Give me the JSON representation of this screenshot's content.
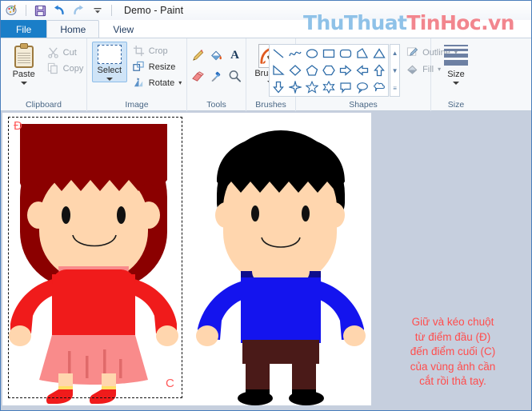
{
  "window": {
    "title": "Demo - Paint",
    "quick_access": [
      {
        "name": "paint-app-icon",
        "glyph": "🎨"
      },
      {
        "name": "save-icon",
        "glyph": "💾"
      },
      {
        "name": "undo-icon",
        "glyph": "↶"
      },
      {
        "name": "redo-icon",
        "glyph": "↷"
      },
      {
        "name": "customize-quick-access-icon",
        "glyph": "▾"
      }
    ]
  },
  "tabs": [
    {
      "label": "File",
      "type": "file"
    },
    {
      "label": "Home",
      "type": "active"
    },
    {
      "label": "View",
      "type": "normal"
    }
  ],
  "ribbon": {
    "clipboard": {
      "label": "Clipboard",
      "paste": "Paste",
      "cut": "Cut",
      "copy": "Copy"
    },
    "image": {
      "label": "Image",
      "select": "Select",
      "crop": "Crop",
      "resize": "Resize",
      "rotate": "Rotate"
    },
    "tools": {
      "label": "Tools",
      "items": [
        {
          "name": "pencil-tool-icon",
          "glyph": "✏"
        },
        {
          "name": "fill-with-color-icon",
          "glyph": "🪣"
        },
        {
          "name": "text-tool-icon",
          "glyph": "A"
        },
        {
          "name": "eraser-tool-icon",
          "glyph": "▬"
        },
        {
          "name": "color-picker-icon",
          "glyph": "💉"
        },
        {
          "name": "magnifier-tool-icon",
          "glyph": "🔍"
        }
      ]
    },
    "brushes": {
      "label": "Brushes",
      "button": "Brushes"
    },
    "shapes": {
      "label": "Shapes",
      "outline": "Outline",
      "fill": "Fill",
      "items": [
        "line",
        "curve",
        "oval",
        "rectangle",
        "rounded-rectangle",
        "polygon",
        "triangle",
        "right-triangle",
        "diamond",
        "pentagon",
        "hexagon",
        "right-arrow",
        "left-arrow",
        "up-arrow",
        "down-arrow",
        "four-point-star",
        "five-point-star",
        "six-point-star",
        "rounded-callout",
        "oval-callout",
        "cloud-callout"
      ]
    },
    "size": {
      "label": "Size",
      "button": "Size"
    }
  },
  "watermark": {
    "part_a": "ThuThuat",
    "part_b": "TinHoc.vn",
    "color_a": "#8fc2e8",
    "color_b": "#f2868e"
  },
  "canvas": {
    "selection_markers": {
      "start": "Đ",
      "end": "C",
      "color": "#ff5a5a"
    },
    "girl": {
      "hair": "#8b0000",
      "skin": "#ffd6ae",
      "top": "#f01b1b",
      "collar": "#f98b8b",
      "skirt": "#f98b8b",
      "socks": "#ffe066",
      "shoes": "#f01b1b"
    },
    "boy": {
      "hair": "#000000",
      "skin": "#ffd6ae",
      "sweater": "#1414ee",
      "collar": "#0d0d8c",
      "pants": "#4a1a18",
      "shoes": "#000000"
    }
  },
  "instruction": {
    "color": "#ff4d4d",
    "lines": [
      "Giữ và kéo chuột",
      "từ điểm đầu (Đ)",
      "đến điểm cuối (C)",
      "của vùng ảnh cần",
      "cắt rồi thả tay."
    ]
  }
}
